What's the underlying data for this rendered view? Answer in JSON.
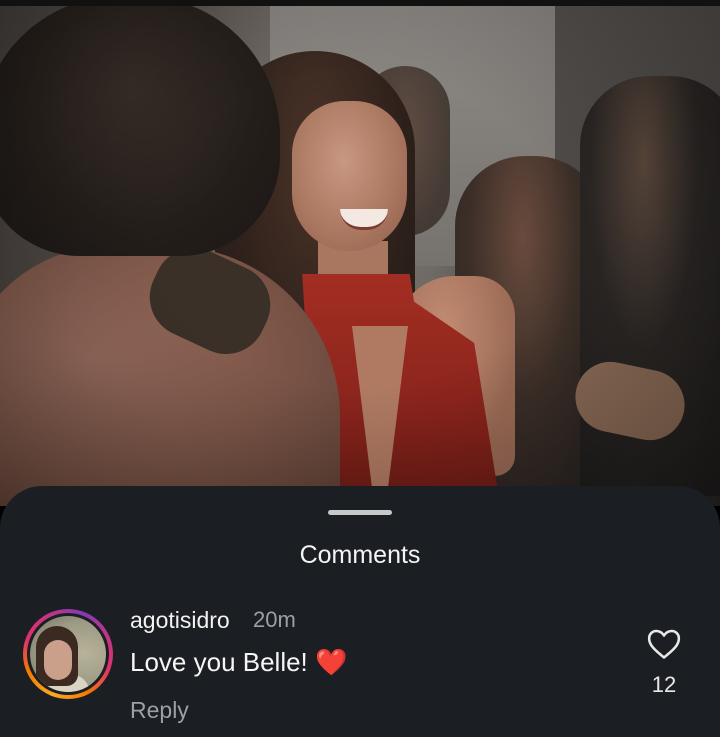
{
  "sheet": {
    "title": "Comments"
  },
  "comments": [
    {
      "username": "agotisidro",
      "time": "20m",
      "text": "Love you Belle! ❤️",
      "reply_label": "Reply",
      "like_count": "12",
      "avatar": "user-avatar-photo"
    }
  ],
  "icons": {
    "like": "heart-outline-icon",
    "emoji": "red-heart"
  },
  "colors": {
    "sheet_background": "#1b1e22",
    "secondary_text": "#9aa0a6",
    "story_ring": [
      "#f9a825",
      "#e1306c",
      "#833ab4"
    ]
  }
}
